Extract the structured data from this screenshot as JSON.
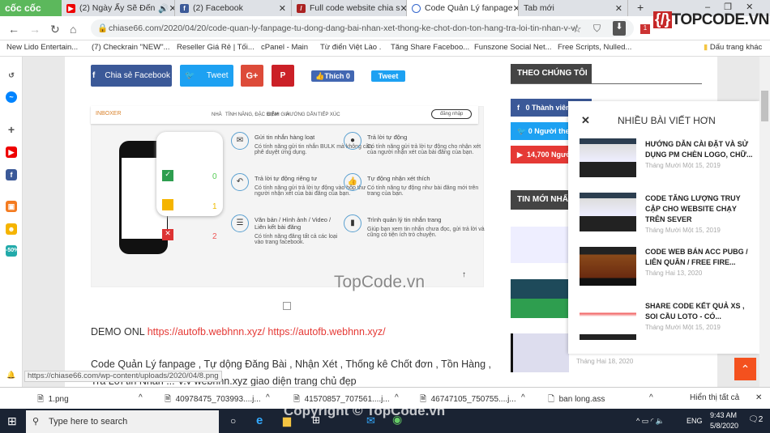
{
  "browser": {
    "brand": "cốc cốc",
    "tabs": [
      {
        "title": "(2) Ngày Ấy Sẽ Đến",
        "icon": "youtube-icon",
        "audio": true
      },
      {
        "title": "(2) Facebook",
        "icon": "facebook-icon"
      },
      {
        "title": "Full code website chia s",
        "icon": "site-icon"
      },
      {
        "title": "Code Quản Lý fanpage",
        "icon": "chiase66-icon",
        "active": true
      },
      {
        "title": "Tab mới"
      }
    ],
    "url": "chiase66.com/2020/04/20/code-quan-ly-fanpage-tu-dong-dang-bai-nhan-xet-thong-ke-chot-don-ton-hang-tra-loi-tin-nhan-v-v/",
    "bookmarks": [
      "New Lido Entertain...",
      "(7) Checkrain \"NEW\"...",
      "Reseller Giá Rẻ | Tối...",
      "cPanel - Main",
      "Từ điển Việt Lào .",
      "Tăng Share Faceboo...",
      "Funszone Social Net...",
      "Free Scripts, Nulled..."
    ],
    "bookmarks_other": "Dấu trang khác",
    "ext_badge": "1",
    "watermark_logo": "TOPCODE.VN"
  },
  "share": {
    "facebook": "Chia sẻ Facebook",
    "twitter": "Tweet",
    "gplus": "G+",
    "pinterest": "P",
    "like": "Thích 0",
    "tweet_small": "Tweet"
  },
  "screenshot": {
    "logo": "INBOXER",
    "nav": [
      "NHÀ",
      "TÍNH NĂNG, ĐẶC ĐIỂM",
      "ĐỊNH GIÁ",
      "HƯỚNG DẪN",
      "TIẾP XÚC"
    ],
    "login": "đăng nhập",
    "features": [
      {
        "title": "Gửi tin nhắn hàng loạt",
        "desc": "Có tính năng gửi tin nhắn BULK mà không cần phê duyệt ứng dụng."
      },
      {
        "title": "Trả lời tự động",
        "desc": "Có tính năng gửi trả lời tự động cho nhận xét của người nhận xét của bài đăng của bạn."
      },
      {
        "title": "Trả lời tự động riêng tư",
        "desc": "Có tính năng gửi trả lời tự động vào hộp thư người nhận xét của bài đăng của bạn."
      },
      {
        "title": "Tự động nhận xét thích",
        "desc": "Có tính năng tự động như bài đăng mới trên trang của bạn."
      },
      {
        "title": "Văn bản / Hình ảnh / Video / Liên kết bài đăng",
        "desc": "Có tính năng đăng tất cả các loại vào trang facebook."
      },
      {
        "title": "Trình quản lý tin nhắn trang",
        "desc": "Giúp bạn xem tin nhắn chưa đọc, gửi trả lời và cũng có tiện ích trò chuyện."
      }
    ],
    "counts": [
      "0",
      "1",
      "2"
    ],
    "watermark": "TopCode.vn"
  },
  "article": {
    "demo_label": "DEMO ONL",
    "demo_links": [
      "https://autofb.webhnn.xyz/",
      "https://autofb.webhnn.xyz/"
    ],
    "paragraph": "Code Quản Lý fanpage , Tự dộng Đăng Bài , Nhận Xét , Thống kê Chốt đơn , Tồn Hàng ,",
    "paragraph2": "Trả Lời tin Nhắn ... V.v webhnn.xyz giao diện trang chủ đẹp"
  },
  "status_url": "https://chiase66.com/wp-content/uploads/2020/04/8.png",
  "sidebar": {
    "follow_title": "THEO CHÚNG TÔI",
    "follow": [
      {
        "count": "0",
        "label": "Thành viên",
        "color": "#3b5998"
      },
      {
        "count": "0",
        "label": "Người theo dõi",
        "color": "#1da1f2"
      },
      {
        "count": "14,700",
        "label": "Người đăng ký",
        "color": "#e53935"
      }
    ],
    "latest_title": "TIN MỚI NHẤT",
    "latest_date": "Tháng Hai 18, 2020"
  },
  "popup": {
    "title": "NHIỀU BÀI VIẾT HƠN",
    "items": [
      {
        "title": "HƯỚNG DẪN CÀI ĐẶT VÀ SỬ DỤNG PM CHÈN LOGO, CHỮ...",
        "date": "Tháng Mười Một 15, 2019"
      },
      {
        "title": "CODE TĂNG LƯỢNG TRUY CẬP CHO WEBSITE CHẠY TRÊN SEVER",
        "date": "Tháng Mười Một 15, 2019"
      },
      {
        "title": "CODE WEB BÁN ACC PUBG / LIÊN QUÂN / FREE FIRE...",
        "date": "Tháng Hai 13, 2020"
      },
      {
        "title": "SHARE CODE KẾT QUẢ XS , SOI CẦU LOTO - CÓ...",
        "date": "Tháng Mười Một 15, 2019"
      }
    ]
  },
  "downloads": {
    "files": [
      "1.png",
      "40978475_703993....j...",
      "41570857_707561....j...",
      "46747105_750755....j...",
      "ban long.ass"
    ],
    "show_all": "Hiển thị tất cả"
  },
  "taskbar": {
    "search_placeholder": "Type here to search",
    "lang": "ENG",
    "time": "9:43 AM",
    "date": "5/8/2020",
    "notif": "2",
    "copyright": "Copyright © TopCode.vn"
  },
  "colors": {
    "accent": "#f4511e",
    "facebook": "#3b5998",
    "twitter": "#1da1f2",
    "gplus": "#dd4b39",
    "pinterest": "#cb2027",
    "link": "#e53935"
  }
}
